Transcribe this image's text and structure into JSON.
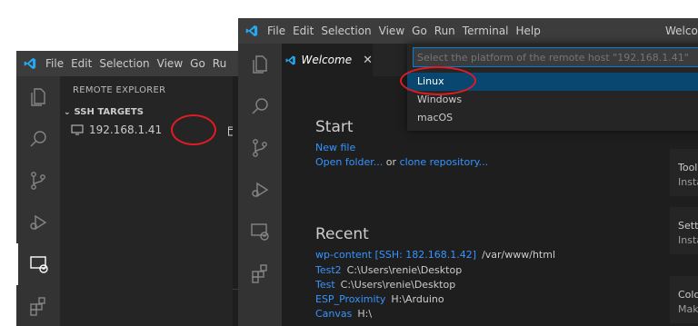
{
  "back_window": {
    "menu": [
      "File",
      "Edit",
      "Selection",
      "View",
      "Go",
      "Ru"
    ],
    "sidebar_title": "REMOTE EXPLORER",
    "section_header": "SSH TARGETS",
    "host_label": "192.168.1.41",
    "editor_partial_letter": "D"
  },
  "front_window": {
    "menu": [
      "File",
      "Edit",
      "Selection",
      "View",
      "Go",
      "Run",
      "Terminal",
      "Help"
    ],
    "title_partial": "Welcom",
    "tab_label": "Welcome",
    "tab_close": "✕",
    "quickpick": {
      "placeholder": "Select the platform of the remote host \"192.168.1.41\"",
      "options": [
        "Linux",
        "Windows",
        "macOS"
      ],
      "selected": "Linux"
    },
    "start": {
      "heading": "Start",
      "new_file": "New file",
      "open_folder": "Open folder...",
      "or_text": "or",
      "clone_repo": "clone repository..."
    },
    "recent": {
      "heading": "Recent",
      "items": [
        {
          "name": "wp-content [SSH: 182.168.1.42]",
          "path": "/var/www/html"
        },
        {
          "name": "Test2",
          "path": "C:\\Users\\renie\\Desktop"
        },
        {
          "name": "Test",
          "path": "C:\\Users\\renie\\Desktop"
        },
        {
          "name": "ESP_Proximity",
          "path": "H:\\Arduino"
        },
        {
          "name": "Canvas",
          "path": "H:\\"
        }
      ]
    },
    "right_cards": [
      {
        "title": "Tool",
        "sub": "Insta"
      },
      {
        "title": "Setti",
        "sub": "Insta"
      },
      {
        "title": "Colo",
        "sub": "Mak"
      }
    ],
    "right_partial_heading": "Cust"
  },
  "colors": {
    "accent": "#007acc",
    "link": "#3794ff",
    "selection": "#094771",
    "highlight_ring": "#e01b24"
  }
}
